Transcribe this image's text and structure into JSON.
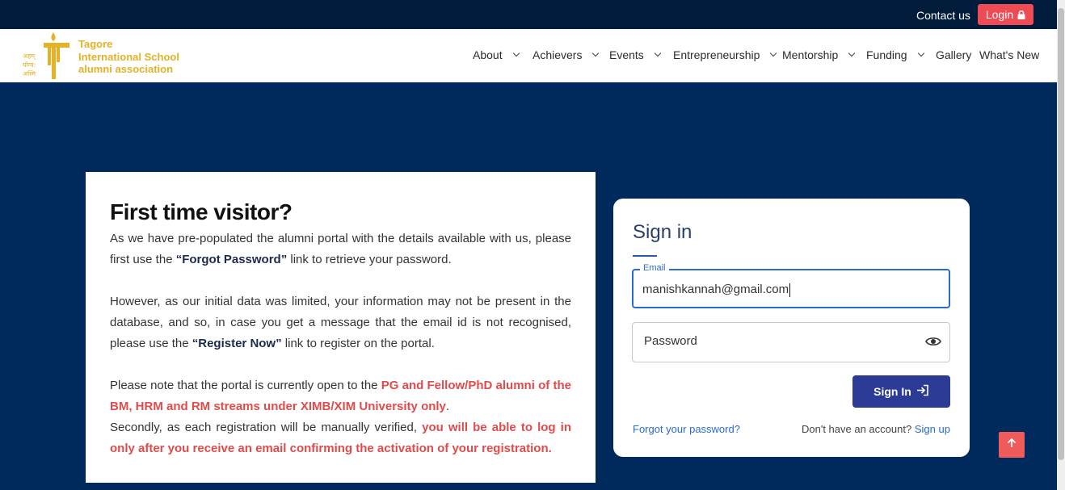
{
  "topbar": {
    "contact_label": "Contact us",
    "login_label": "Login",
    "login_icon": "lock-icon"
  },
  "brand": {
    "line1": "Tagore",
    "line2": "International School",
    "line3": "alumni association",
    "logo_script_1": "अहम्",
    "logo_script_2": "योग्य:",
    "logo_script_3": "अस्मि",
    "color": "#e3b227"
  },
  "nav": {
    "items": [
      {
        "label": "About",
        "has_dropdown": true
      },
      {
        "label": "Achievers",
        "has_dropdown": true
      },
      {
        "label": "Events",
        "has_dropdown": true
      },
      {
        "label": "Entrepreneurship",
        "has_dropdown": true
      },
      {
        "label": "Mentorship",
        "has_dropdown": true
      },
      {
        "label": "Funding",
        "has_dropdown": true
      },
      {
        "label": "Gallery",
        "has_dropdown": false
      },
      {
        "label": "What's New",
        "has_dropdown": false
      }
    ]
  },
  "info": {
    "title": "First time visitor?",
    "p1_a": "As we have pre-populated the alumni portal with the details available with us, please first use the ",
    "p1_b": "“Forgot Password”",
    "p1_c": " link to retrieve your password.",
    "p2_a": "However, as our initial data was limited, your information may not be present in the database, and so, in case you get a message that the email id is not recognised, please use the ",
    "p2_b": "“Register Now”",
    "p2_c": " link to register on the portal.",
    "p3_a": "Please note that the portal is currently open to the ",
    "p3_b": "PG and Fellow/PhD alumni of the BM, HRM and RM streams under XIMB/XIM University only",
    "p3_c": ".",
    "p4_a": "Secondly, as each registration will be manually verified, ",
    "p4_b": "you will be able to log in only after you receive an email confirming the activation of your registration."
  },
  "signin": {
    "title": "Sign in",
    "email_label": "Email",
    "email_value": "manishkannah@gmail.com",
    "password_label": "Password",
    "eye_icon": "eye-icon",
    "button_label": "Sign In",
    "button_icon": "sign-in-icon",
    "forgot_label": "Forgot your password?",
    "no_account_text": "Don't have an account?",
    "signup_label": "Sign up"
  },
  "colors": {
    "page_bg": "#012a5c",
    "topbar_bg": "#011c3a",
    "accent_red": "#ef4b55",
    "primary_button": "#2b3b96",
    "link_blue": "#2b6ad1"
  },
  "back_to_top_icon": "arrow-up-icon"
}
